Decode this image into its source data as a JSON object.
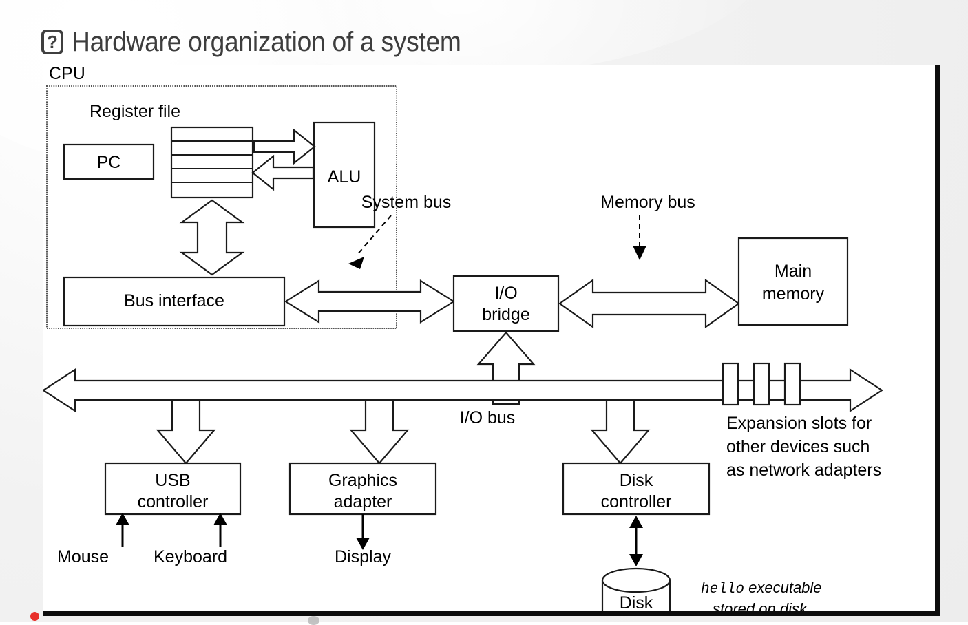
{
  "slide": {
    "title": "Hardware organization of a system",
    "missing_glyph": "?",
    "title_color": "#3d3d3d",
    "background_color": "#eeeeee",
    "figure_border_color": "#0d0d0d",
    "accent_dot_color": "#e8302a"
  },
  "diagram": {
    "type": "block-diagram",
    "stroke_color": "#1a1a1a",
    "fill_color": "#ffffff",
    "cpu_group_label": "CPU",
    "blocks": [
      {
        "id": "pc",
        "label": "PC"
      },
      {
        "id": "register-file",
        "label": "Register file",
        "rows": 5
      },
      {
        "id": "alu",
        "label": "ALU"
      },
      {
        "id": "bus-interface",
        "label": "Bus interface"
      },
      {
        "id": "io-bridge",
        "label_line1": "I/O",
        "label_line2": "bridge"
      },
      {
        "id": "main-memory",
        "label_line1": "Main",
        "label_line2": "memory"
      },
      {
        "id": "usb-controller",
        "label_line1": "USB",
        "label_line2": "controller"
      },
      {
        "id": "graphics-adapter",
        "label_line1": "Graphics",
        "label_line2": "adapter"
      },
      {
        "id": "disk-controller",
        "label_line1": "Disk",
        "label_line2": "controller"
      },
      {
        "id": "disk",
        "label": "Disk"
      }
    ],
    "bus_labels": [
      {
        "id": "system-bus",
        "label": "System bus"
      },
      {
        "id": "memory-bus",
        "label": "Memory bus"
      },
      {
        "id": "io-bus",
        "label": "I/O bus"
      }
    ],
    "device_labels": [
      {
        "id": "mouse",
        "label": "Mouse"
      },
      {
        "id": "keyboard",
        "label": "Keyboard"
      },
      {
        "id": "display",
        "label": "Display"
      }
    ],
    "annotations": [
      {
        "id": "expansion-slots",
        "line1": "Expansion slots for",
        "line2": "other devices such",
        "line3": "as network adapters"
      },
      {
        "id": "disk-note",
        "mono": "hello",
        "line1_rest": " executable",
        "line2": "stored on disk"
      }
    ],
    "expansion_slot_count": 3
  }
}
